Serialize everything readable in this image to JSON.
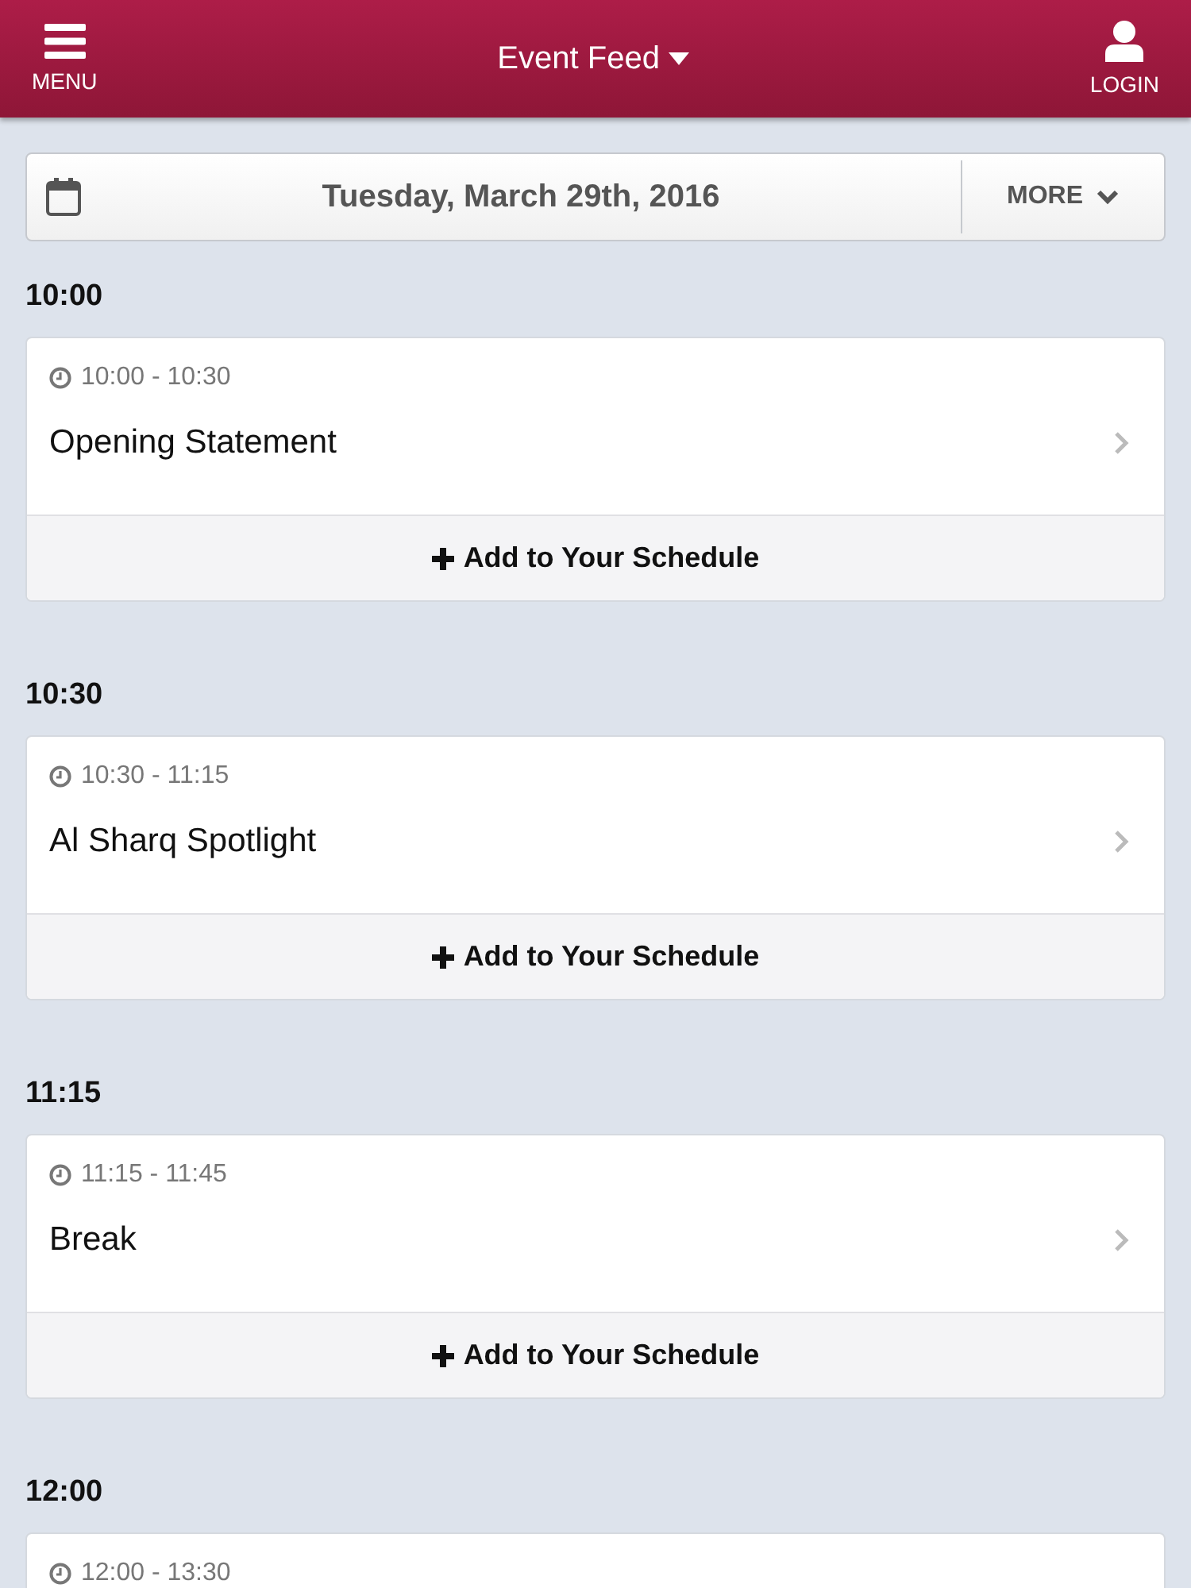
{
  "header": {
    "menu_label": "MENU",
    "title": "Event Feed",
    "login_label": "LOGIN"
  },
  "date_bar": {
    "date": "Tuesday, March 29th, 2016",
    "more_label": "MORE"
  },
  "sections": [
    {
      "heading": "10:00",
      "events": [
        {
          "time": "10:00 - 10:30",
          "title": "Opening Statement",
          "action": "Add to Your Schedule"
        }
      ]
    },
    {
      "heading": "10:30",
      "events": [
        {
          "time": "10:30 - 11:15",
          "title": "Al Sharq Spotlight",
          "action": "Add to Your Schedule"
        }
      ]
    },
    {
      "heading": "11:15",
      "events": [
        {
          "time": "11:15 - 11:45",
          "title": "Break",
          "action": "Add to Your Schedule"
        }
      ]
    },
    {
      "heading": "12:00",
      "events": [
        {
          "time": "12:00 - 13:30"
        }
      ]
    }
  ]
}
